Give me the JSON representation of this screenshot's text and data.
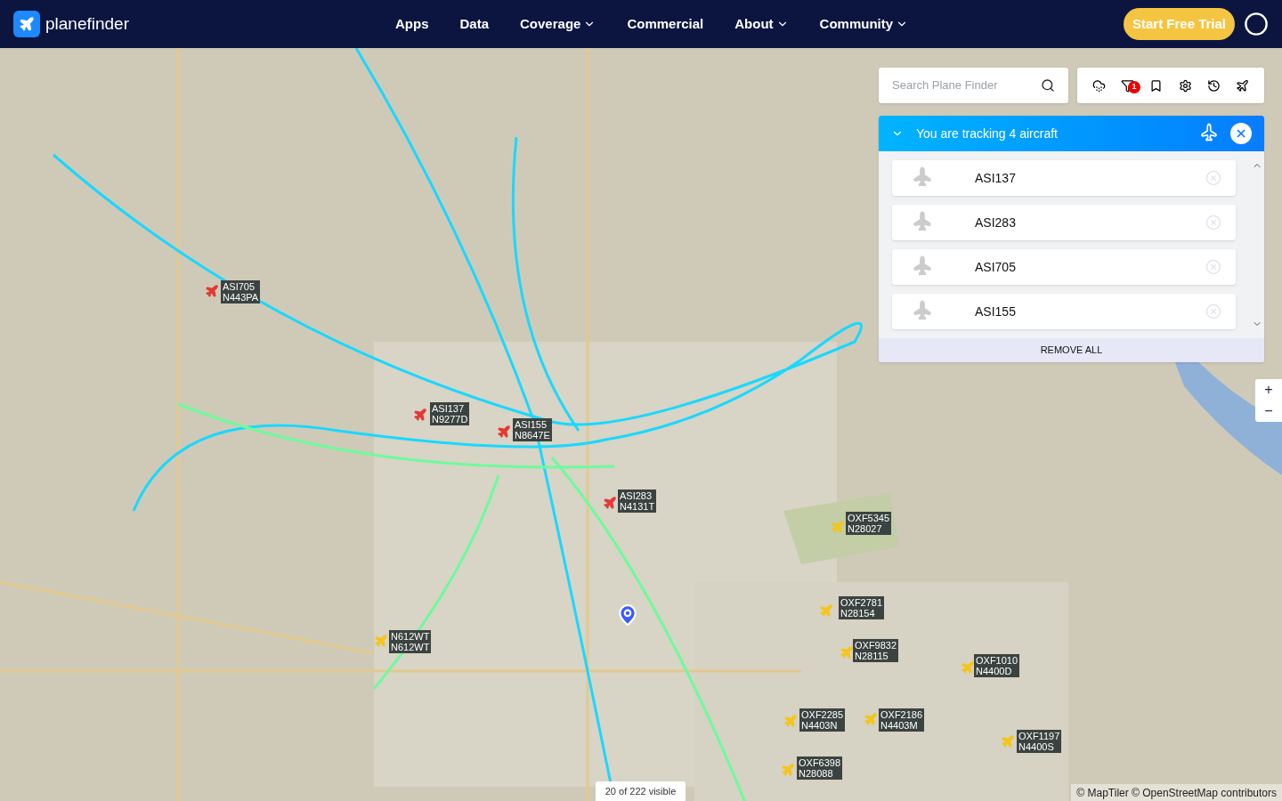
{
  "header": {
    "logo": "planefinder",
    "nav": [
      {
        "label": "Apps",
        "dropdown": false
      },
      {
        "label": "Data",
        "dropdown": false
      },
      {
        "label": "Coverage",
        "dropdown": true
      },
      {
        "label": "Commercial",
        "dropdown": false
      },
      {
        "label": "About",
        "dropdown": true
      },
      {
        "label": "Community",
        "dropdown": true
      }
    ],
    "cta": "Start Free Trial"
  },
  "search": {
    "placeholder": "Search Plane Finder"
  },
  "toolbar": {
    "filter_badge": "1"
  },
  "tracking": {
    "title": "You are tracking 4 aircraft",
    "expanded": true,
    "items": [
      "ASI137",
      "ASI283",
      "ASI705",
      "ASI155"
    ],
    "remove_all": "REMOVE ALL"
  },
  "zoom": {
    "in": "+",
    "out": "−"
  },
  "markers": [
    {
      "callsign": "ASI705",
      "reg": "N443PA",
      "color": "#e53935"
    },
    {
      "callsign": "ASI137",
      "reg": "N9277D",
      "color": "#e53935"
    },
    {
      "callsign": "ASI155",
      "reg": "N8647E",
      "color": "#e53935"
    },
    {
      "callsign": "ASI283",
      "reg": "N4131T",
      "color": "#e53935"
    },
    {
      "callsign": "N612WT",
      "reg": "N612WT",
      "color": "#f5c518"
    },
    {
      "callsign": "OXF5345",
      "reg": "N28027",
      "color": "#f5c518"
    },
    {
      "callsign": "OXF2781",
      "reg": "N28154",
      "color": "#f5c518"
    },
    {
      "callsign": "OXF9832",
      "reg": "N28115",
      "color": "#f5c518"
    },
    {
      "callsign": "OXF1010",
      "reg": "N4400D",
      "color": "#f5c518"
    },
    {
      "callsign": "OXF2285",
      "reg": "N4403N",
      "color": "#f5c518"
    },
    {
      "callsign": "OXF2186",
      "reg": "N4403M",
      "color": "#f5c518"
    },
    {
      "callsign": "OXF1197",
      "reg": "N4400S",
      "color": "#f5c518"
    },
    {
      "callsign": "OXF6398",
      "reg": "N28088",
      "color": "#f5c518"
    }
  ],
  "visible_count": "20 of 222 visible",
  "attribution": "© MapTiler © OpenStreetMap contributors"
}
